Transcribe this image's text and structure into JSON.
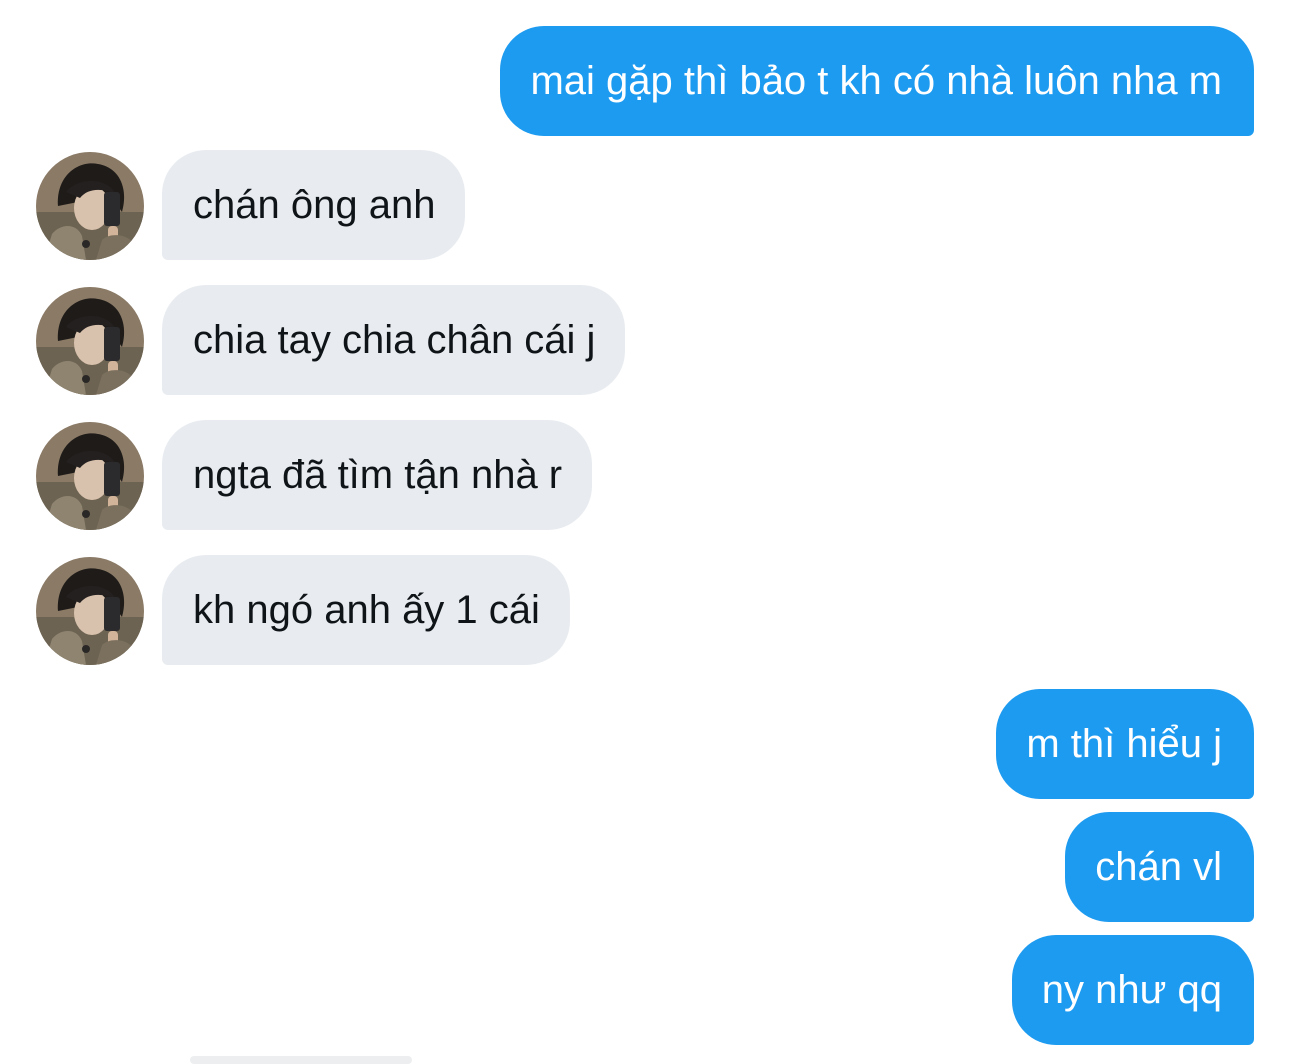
{
  "colors": {
    "outgoing_bubble": "#1d9bf0",
    "incoming_bubble": "#e8ecf0",
    "outgoing_text": "#ffffff",
    "incoming_text": "#0f1419",
    "background": "#ffffff"
  },
  "messages": [
    {
      "direction": "outgoing",
      "text": "mai gặp thì bảo t kh có nhà luôn nha m"
    },
    {
      "direction": "incoming",
      "text": "chán ông anh",
      "avatar_icon": "profile-photo-icon"
    },
    {
      "direction": "incoming",
      "text": "chia tay chia chân cái j",
      "avatar_icon": "profile-photo-icon"
    },
    {
      "direction": "incoming",
      "text": "ngta đã tìm tận nhà r",
      "avatar_icon": "profile-photo-icon"
    },
    {
      "direction": "incoming",
      "text": "kh ngó anh ấy 1 cái",
      "avatar_icon": "profile-photo-icon"
    },
    {
      "direction": "outgoing",
      "text": "m thì hiểu j"
    },
    {
      "direction": "outgoing",
      "text": "chán vl"
    },
    {
      "direction": "outgoing",
      "text": "ny như qq"
    }
  ]
}
